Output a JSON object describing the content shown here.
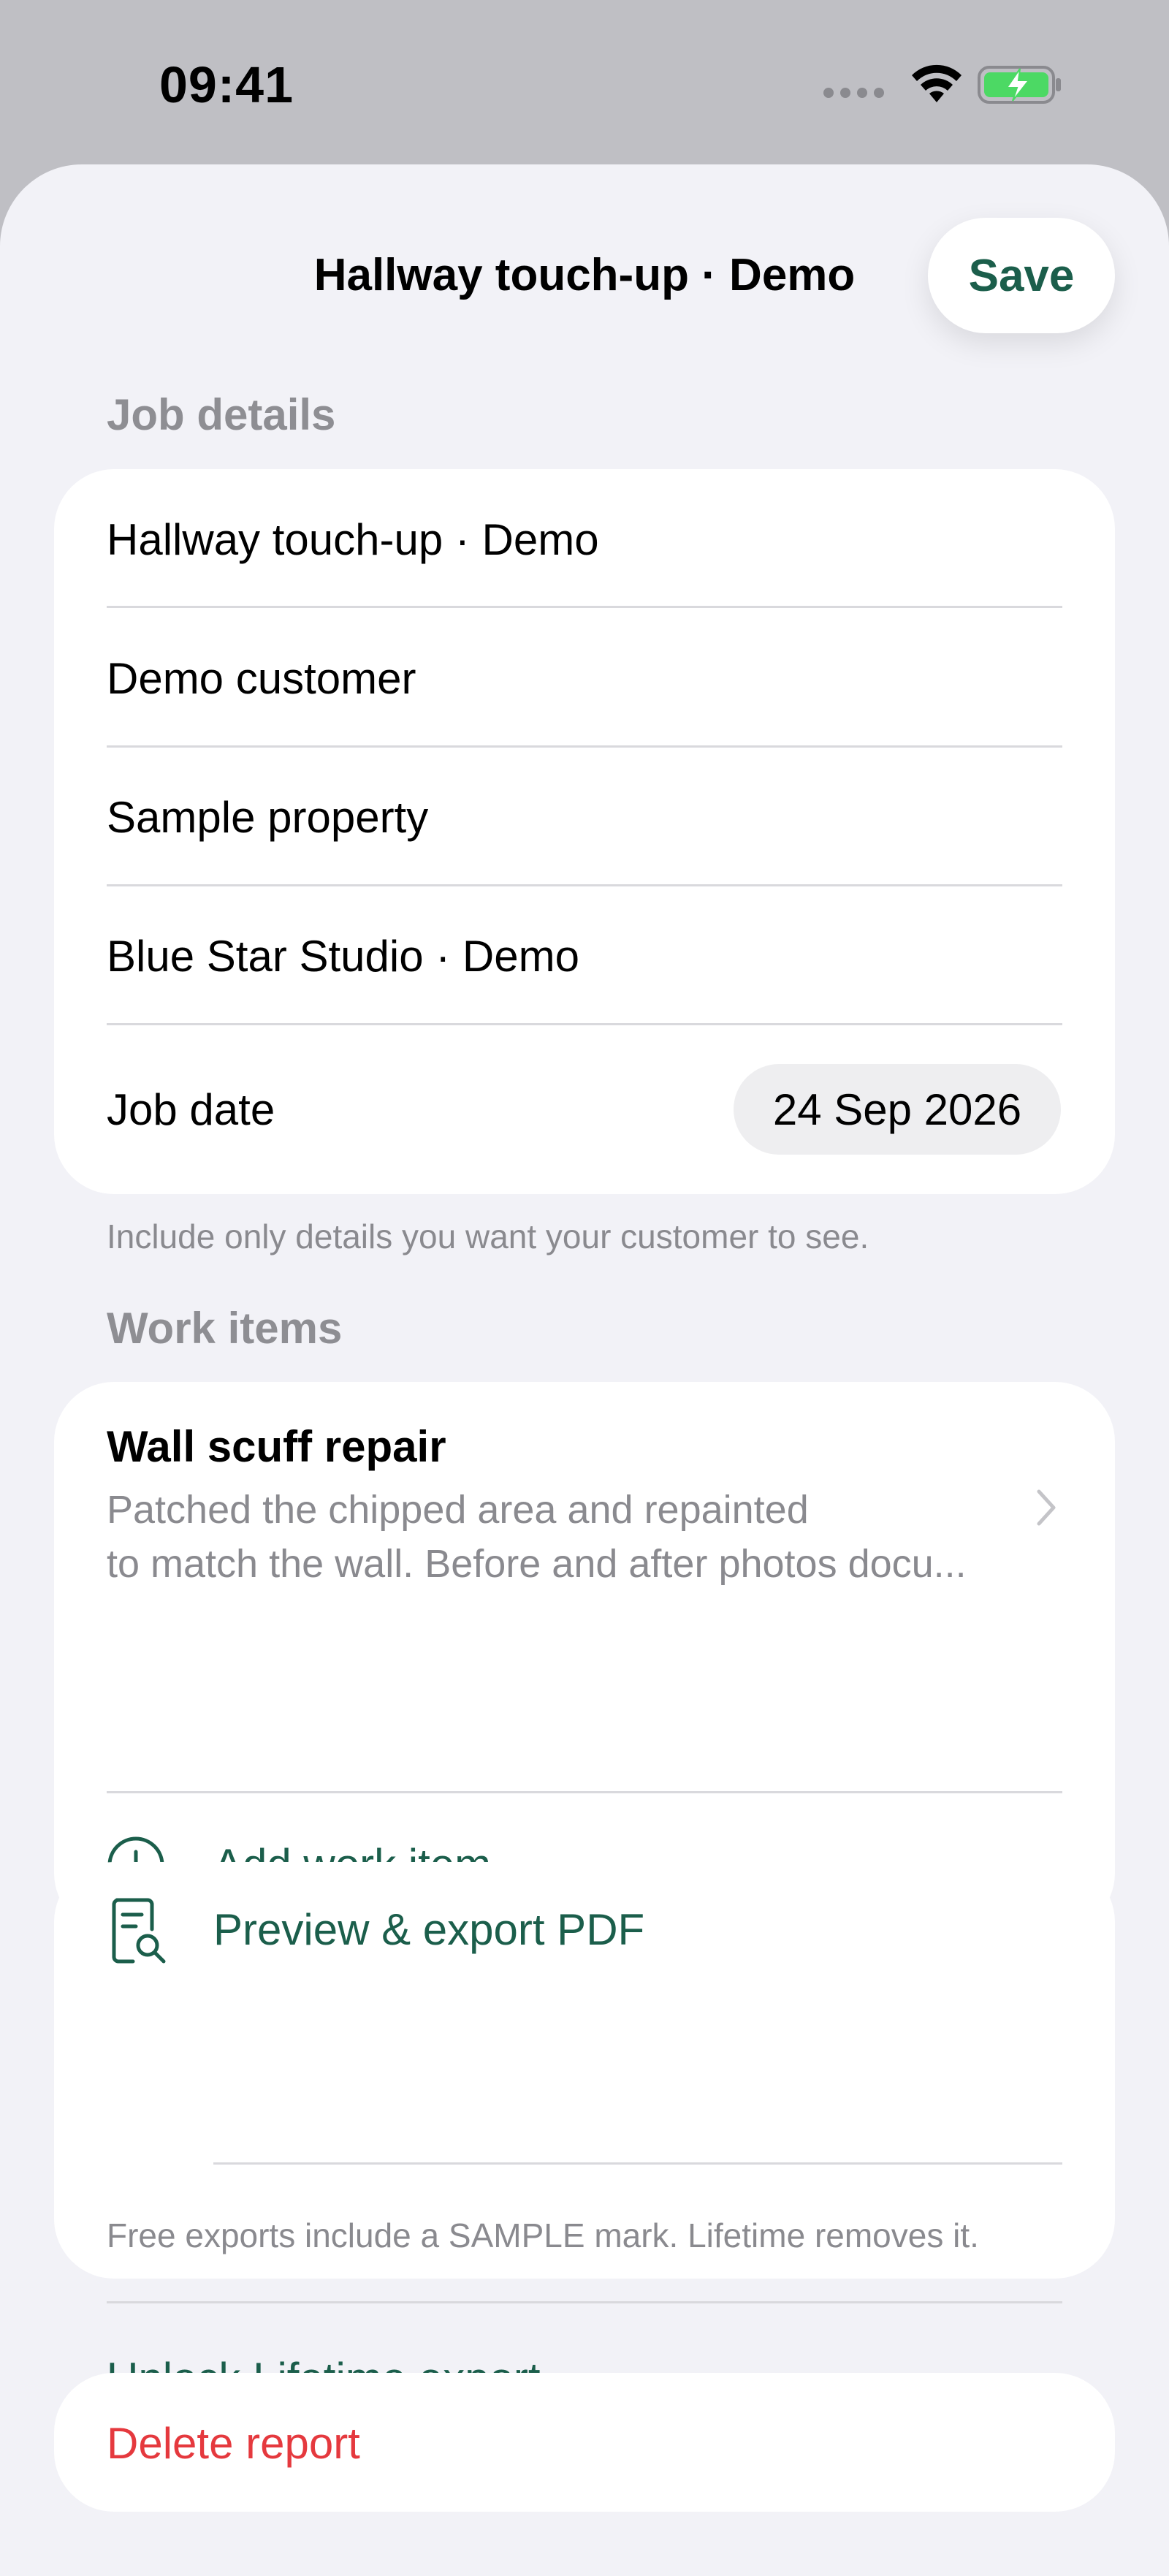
{
  "status_bar": {
    "time": "09:41"
  },
  "nav": {
    "title": "Hallway touch-up · Demo",
    "save_label": "Save"
  },
  "job_details": {
    "label": "Job details",
    "job_title": "Hallway touch-up · Demo",
    "customer": "Demo customer",
    "property": "Sample property",
    "company": "Blue Star Studio · Demo",
    "date_label": "Job date",
    "date_value": "24 Sep 2026",
    "footnote": "Include only details you want your customer to see."
  },
  "work_items": {
    "label": "Work items",
    "items": [
      {
        "title": "Wall scuff repair",
        "desc_line1": "Patched the chipped area and repainted",
        "desc_line2": "to match the wall. Before and after photos docu..."
      }
    ],
    "add_label": "Add work item"
  },
  "export": {
    "preview_label": "Preview & export PDF",
    "note": "Free exports include a SAMPLE mark. Lifetime removes it.",
    "unlock_label": "Unlock Lifetime export"
  },
  "delete_label": "Delete report",
  "colors": {
    "accent": "#1b5e4b",
    "destructive": "#e5393e",
    "battery_green": "#4cd964",
    "background": "#f2f2f7"
  },
  "icons": [
    "wifi-icon",
    "battery-charging-icon",
    "chevron-right-icon",
    "plus-circle-icon",
    "document-search-icon"
  ]
}
